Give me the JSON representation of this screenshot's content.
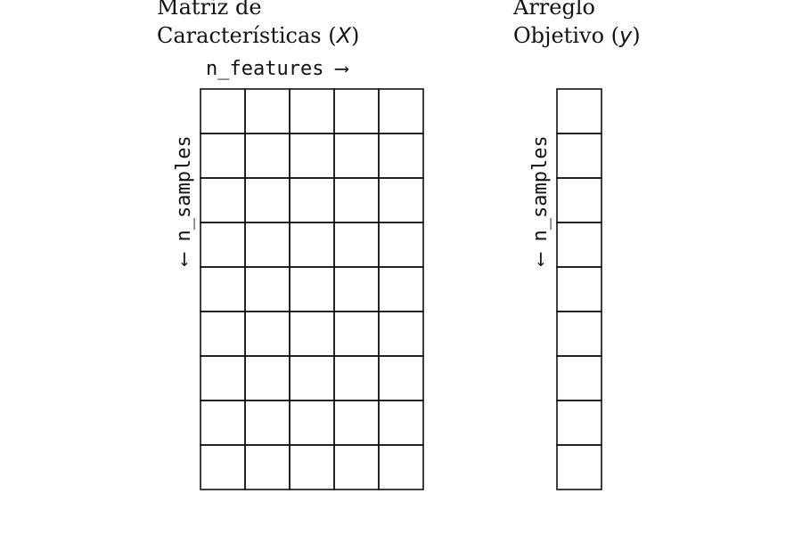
{
  "matrix": {
    "title_line1": "Matriz de",
    "title_line2": "Características (",
    "symbol": "X",
    "close": ")",
    "features_label": "n_features ⟶",
    "samples_label": "⟵ n_samples",
    "rows": 9,
    "cols": 5
  },
  "target": {
    "title_line1": "Arreglo",
    "title_line2": "Objetivo (",
    "symbol": "y",
    "close": ")",
    "samples_label": "⟵ n_samples",
    "rows": 9,
    "cols": 1
  },
  "colors": {
    "stroke": "#111111",
    "background": "#ffffff"
  }
}
